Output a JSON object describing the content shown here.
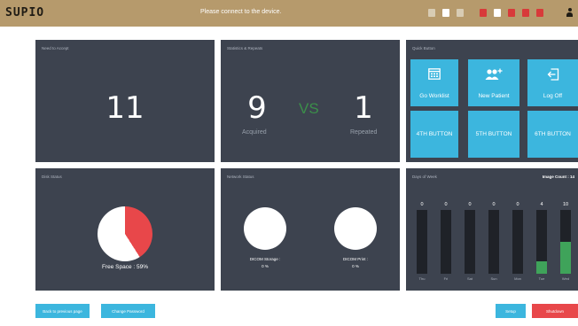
{
  "topbar": {
    "logo": "SUPIO",
    "message": "Please connect to the device.",
    "accent_color": "#b69a6c"
  },
  "need_to_accept": {
    "title": "Need to Accept",
    "count": "11"
  },
  "statistics": {
    "title": "Statistics & Repeats",
    "acquired_count": "9",
    "vs": "VS",
    "repeated_count": "1",
    "acquired_label": "Acquired",
    "repeated_label": "Repeated"
  },
  "quick_button": {
    "title": "Quick Button",
    "buttons": [
      {
        "label": "Go Worklist",
        "icon": "worklist-icon"
      },
      {
        "label": "New Patient",
        "icon": "add-patient-icon"
      },
      {
        "label": "Log Off",
        "icon": "logoff-icon"
      },
      {
        "label": "4TH BUTTON"
      },
      {
        "label": "5TH BUTTON"
      },
      {
        "label": "6TH BUTTON"
      }
    ]
  },
  "disk_status": {
    "title": "Disk Status",
    "free_space_label": "Free Space : 59%",
    "free_fraction": 0.59,
    "free_color": "#ffffff",
    "used_color": "#e8474a"
  },
  "network_status": {
    "title": "Network Status",
    "items": [
      {
        "label": "DICOM Storage :",
        "value": "0 %"
      },
      {
        "label": "DICOM Print :",
        "value": "0 %"
      }
    ]
  },
  "days_of_week": {
    "title": "Days of Week",
    "image_count_label": "Image Count : 14",
    "bars": [
      {
        "day": "Thu",
        "count": 0
      },
      {
        "day": "Fri",
        "count": 0
      },
      {
        "day": "Sat",
        "count": 0
      },
      {
        "day": "Sun",
        "count": 0
      },
      {
        "day": "Mon",
        "count": 0
      },
      {
        "day": "Tue",
        "count": 4
      },
      {
        "day": "Wed",
        "count": 10
      }
    ],
    "max": 20,
    "bar_color": "#3fa35a"
  },
  "footer": {
    "back_label": "Back to previous page",
    "password_label": "Change Password",
    "setup_label": "Setup",
    "shutdown_label": "Shutdown"
  }
}
